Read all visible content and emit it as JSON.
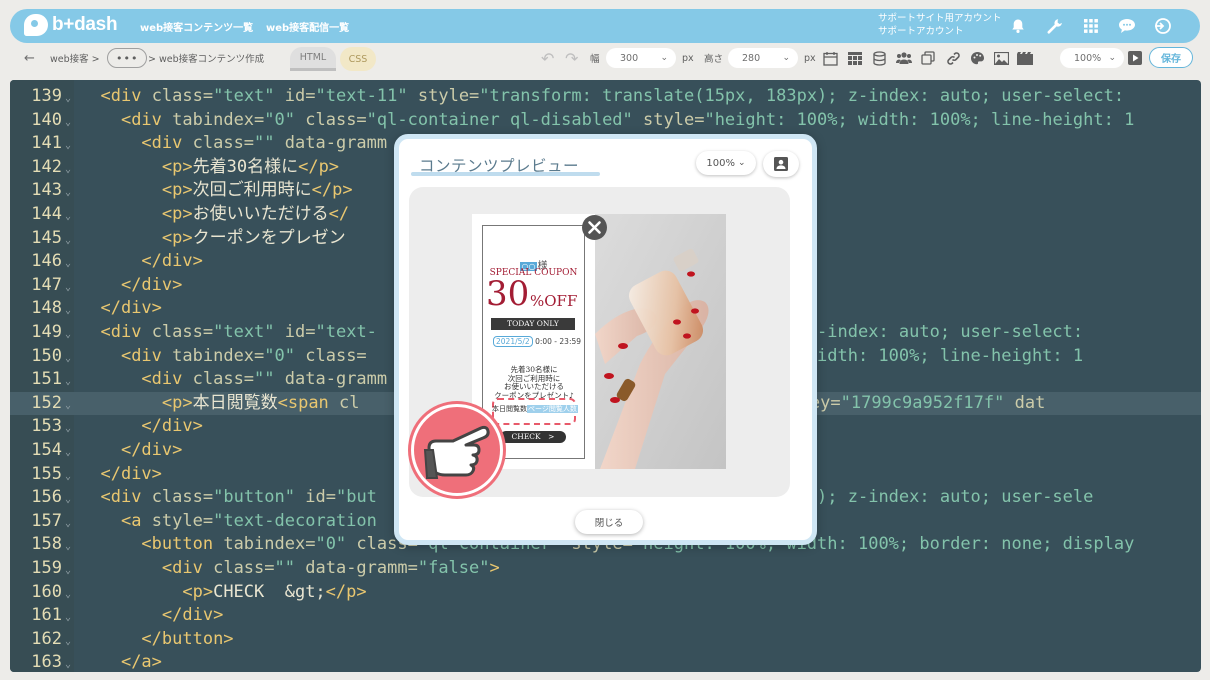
{
  "app": {
    "logo": "b+dash"
  },
  "nav": {
    "items": [
      "web接客コンテンツ一覧",
      "web接客配信一覧"
    ],
    "account_line1": "サポートサイト用アカウント",
    "account_line2": "サポートアカウント"
  },
  "toolbar": {
    "breadcrumb_root": "web接客 >",
    "breadcrumb_more": "•••",
    "breadcrumb_current": "> web接客コンテンツ作成",
    "tab_html": "HTML",
    "tab_css": "CSS",
    "width_label": "幅",
    "width_value": "300",
    "px1": "px",
    "height_label": "高さ",
    "height_value": "280",
    "px2": "px",
    "zoom_value": "100%",
    "save_label": "保存"
  },
  "editor": {
    "lines": [
      {
        "n": "139",
        "html": "<span class=\"tag\">&lt;div</span> <span class=\"attr\">class=</span><span class=\"str\">\"text\"</span> <span class=\"attr\">id=</span><span class=\"str\">\"text-11\"</span> <span class=\"attr\">style=</span><span class=\"str\">\"transform: translate(15px, 183px); z-index: auto; user-select: </span>",
        "indent": 1
      },
      {
        "n": "140",
        "html": "<span class=\"tag\">&lt;div</span> <span class=\"attr\">tabindex=</span><span class=\"str\">\"0\"</span> <span class=\"attr\">class=</span><span class=\"str\">\"ql-container ql-disabled\"</span> <span class=\"attr\">style=</span><span class=\"str\">\"height: 100%; width: 100%; line-height: 1</span>",
        "indent": 2
      },
      {
        "n": "141",
        "html": "<span class=\"tag\">&lt;div</span> <span class=\"attr\">class=</span><span class=\"str\">\"\"</span> <span class=\"attr\">data-gramm</span>",
        "indent": 3
      },
      {
        "n": "142",
        "html": "<span class=\"tag\">&lt;p&gt;</span><span class=\"txt\">先着30名様に</span><span class=\"tag\">&lt;/p&gt;</span>",
        "indent": 4
      },
      {
        "n": "143",
        "html": "<span class=\"tag\">&lt;p&gt;</span><span class=\"txt\">次回ご利用時に</span><span class=\"tag\">&lt;/p&gt;</span>",
        "indent": 4
      },
      {
        "n": "144",
        "html": "<span class=\"tag\">&lt;p&gt;</span><span class=\"txt\">お使いいただける</span><span class=\"tag\">&lt;/</span>",
        "indent": 4
      },
      {
        "n": "145",
        "html": "<span class=\"tag\">&lt;p&gt;</span><span class=\"txt\">クーポンをプレゼン</span>",
        "indent": 4
      },
      {
        "n": "146",
        "html": "<span class=\"tag\">&lt;/div&gt;</span>",
        "indent": 3
      },
      {
        "n": "147",
        "html": "<span class=\"tag\">&lt;/div&gt;</span>",
        "indent": 2
      },
      {
        "n": "148",
        "html": "<span class=\"tag\">&lt;/div&gt;</span>",
        "indent": 1
      },
      {
        "n": "149",
        "html": "<span class=\"tag\">&lt;div</span> <span class=\"attr\">class=</span><span class=\"str\">\"text\"</span> <span class=\"attr\">id=</span><span class=\"str\">\"text-</span>                                   <span class=\"str\">19px); z-index: auto; user-select: </span>",
        "indent": 1
      },
      {
        "n": "150",
        "html": "<span class=\"tag\">&lt;div</span> <span class=\"attr\">tabindex=</span><span class=\"str\">\"0\"</span> <span class=\"attr\">class=</span>                                   <span class=\"str\">: 100%; width: 100%; line-height: 1</span>",
        "indent": 2
      },
      {
        "n": "151",
        "html": "<span class=\"tag\">&lt;div</span> <span class=\"attr\">class=</span><span class=\"str\">\"\"</span> <span class=\"attr\">data-gramm</span>",
        "indent": 3
      },
      {
        "n": "152",
        "html": "<span class=\"tag\">&lt;p&gt;</span><span class=\"txt\">本日閲覧数</span><span class=\"tag\">&lt;span</span> <span class=\"attr\">cl</span>                                <span class=\"str\">page\"</span> <span class=\"attr\">data-key=</span><span class=\"str\">\"1799c9a952f17f\"</span> <span class=\"attr\">dat</span>",
        "indent": 4,
        "hl": true
      },
      {
        "n": "153",
        "html": "<span class=\"tag\">&lt;/div&gt;</span>",
        "indent": 3
      },
      {
        "n": "154",
        "html": "<span class=\"tag\">&lt;/div&gt;</span>",
        "indent": 2
      },
      {
        "n": "155",
        "html": "<span class=\"tag\">&lt;/div&gt;</span>",
        "indent": 1
      },
      {
        "n": "156",
        "html": "<span class=\"tag\">&lt;div</span> <span class=\"attr\">class=</span><span class=\"str\">\"button\"</span> <span class=\"attr\">id=</span><span class=\"str\">\"but</span>                                   <span class=\"str\">x, 255px); z-index: auto; user-sele</span>",
        "indent": 1
      },
      {
        "n": "157",
        "html": "<span class=\"tag\">&lt;a</span> <span class=\"attr\">style=</span><span class=\"str\">\"text-decoration</span>",
        "indent": 2
      },
      {
        "n": "158",
        "html": "<span class=\"tag\">&lt;button</span> <span class=\"attr\">tabindex=</span><span class=\"str\">\"0\"</span> <span class=\"attr\">class=</span><span class=\"str\">\"ql-container\"</span> <span class=\"attr\">style=</span><span class=\"str\">\"height: 100%; width: 100%; border: none; display</span>",
        "indent": 3
      },
      {
        "n": "159",
        "html": "<span class=\"tag\">&lt;div</span> <span class=\"attr\">class=</span><span class=\"str\">\"\"</span> <span class=\"attr\">data-gramm=</span><span class=\"str\">\"false\"</span><span class=\"tag\">&gt;</span>",
        "indent": 4
      },
      {
        "n": "160",
        "html": "<span class=\"tag\">&lt;p&gt;</span><span class=\"txt\">CHECK  &amp;gt;</span><span class=\"tag\">&lt;/p&gt;</span>",
        "indent": 5
      },
      {
        "n": "161",
        "html": "<span class=\"tag\">&lt;/div&gt;</span>",
        "indent": 4
      },
      {
        "n": "162",
        "html": "<span class=\"tag\">&lt;/button&gt;</span>",
        "indent": 3
      },
      {
        "n": "163",
        "html": "<span class=\"tag\">&lt;/a&gt;</span>",
        "indent": 2
      }
    ]
  },
  "modal": {
    "title": "コンテンツプレビュー",
    "zoom": "100%",
    "close_label": "閉じる"
  },
  "coupon": {
    "honorific_name": "○○",
    "honorific_suffix": "様",
    "special": "SPECIAL COUPON",
    "pct": "30",
    "off": "%OFF",
    "today": "TODAY ONLY",
    "date": "2021/5/2",
    "time": "0:00 - 23:59",
    "msg": [
      "先着30名様に",
      "次回ご利用時に",
      "お使いいただける",
      "クーポンをプレゼント♪"
    ],
    "count_prefix": "本日閲覧数",
    "count_tag": "ページ閲覧人数",
    "check": "CHECK　>"
  },
  "colors": {
    "accent": "#7ec6e6",
    "editor_bg": "#2c4650",
    "coupon_red": "#a31d34",
    "pointer": "#ef6f7a"
  },
  "icons": {
    "topbar": [
      "bell-icon",
      "wrench-icon",
      "grid-icon",
      "chat-icon",
      "logout-icon"
    ],
    "toolbar": [
      "undo-icon",
      "redo-icon",
      "calendar-icon",
      "table-icon",
      "database-icon",
      "users-icon",
      "copy-icon",
      "link-icon",
      "palette-icon",
      "image-icon",
      "video-icon",
      "play-icon"
    ]
  }
}
